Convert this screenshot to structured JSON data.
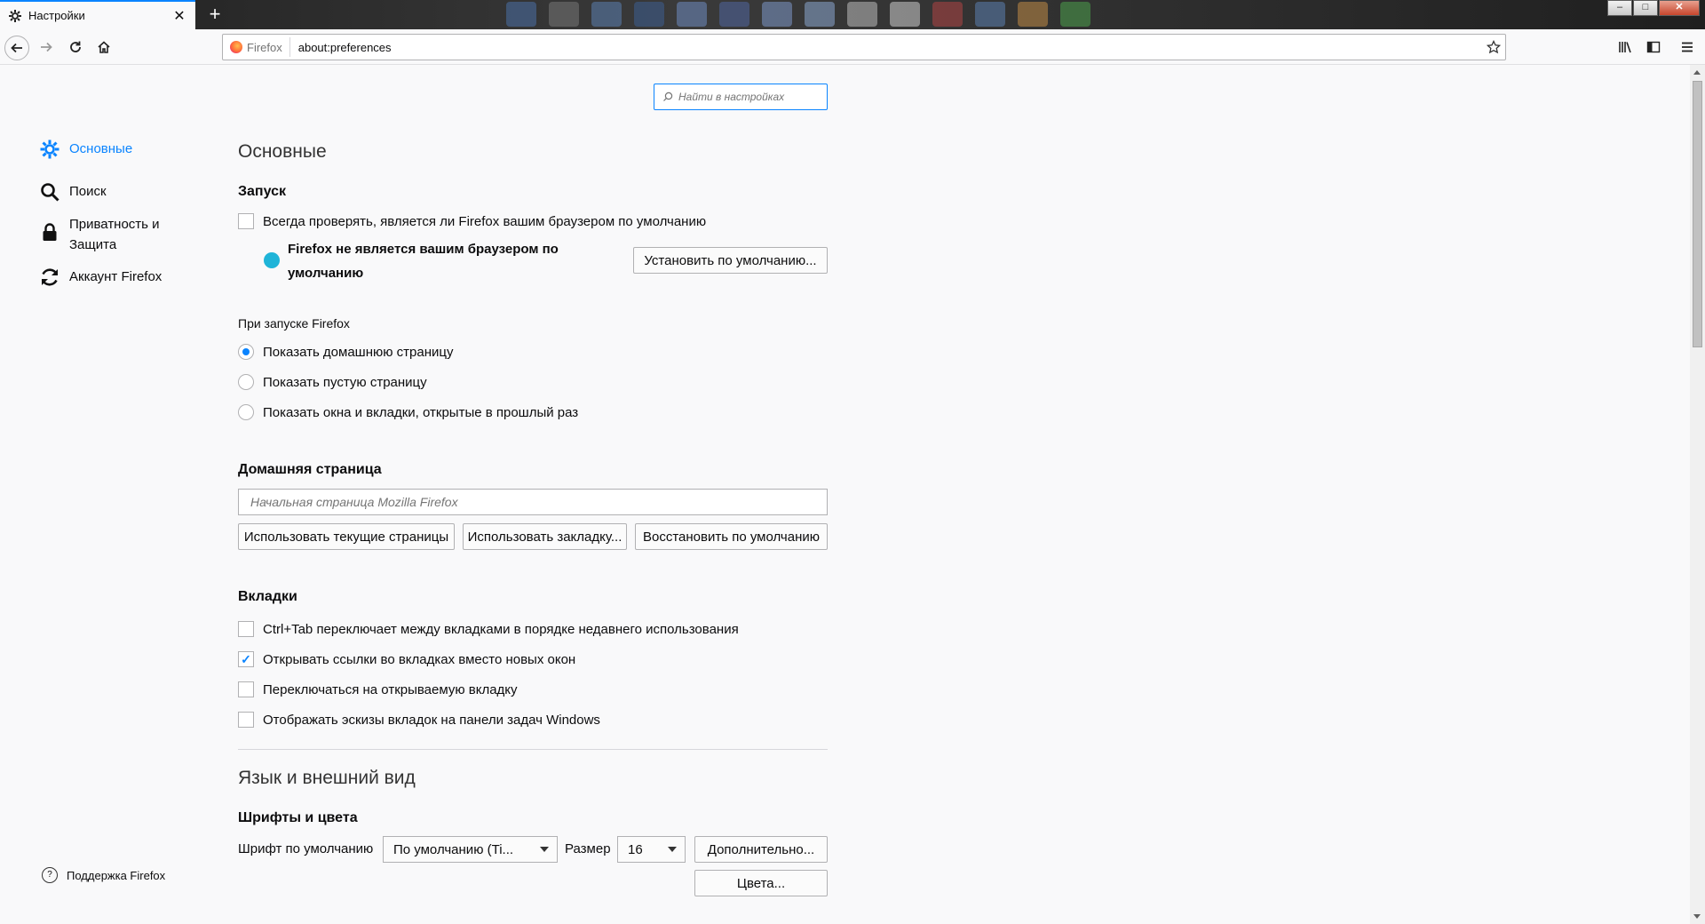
{
  "tab": {
    "title": "Настройки",
    "close": "✕"
  },
  "newtab": "+",
  "window_controls": {
    "minimize": "–",
    "maximize": "□",
    "close": "✕"
  },
  "urlbar": {
    "identity_label": "Firefox",
    "url": "about:preferences"
  },
  "search": {
    "placeholder": "Найти в настройках"
  },
  "sidebar": {
    "items": [
      {
        "label": "Основные",
        "icon": "gear-icon",
        "selected": true
      },
      {
        "label": "Поиск",
        "icon": "search-icon"
      },
      {
        "label": "Приватность и Защита",
        "icon": "lock-icon"
      },
      {
        "label": "Аккаунт Firefox",
        "icon": "sync-icon"
      }
    ],
    "support": "Поддержка Firefox"
  },
  "general": {
    "title": "Основные",
    "startup": {
      "heading": "Запуск",
      "always_check": "Всегда проверять, является ли Firefox вашим браузером по умолчанию",
      "not_default": "Firefox не является вашим браузером по умолчанию",
      "set_default_button": "Установить по умолчанию...",
      "on_start_label": "При запуске Firefox",
      "options": [
        {
          "label": "Показать домашнюю страницу",
          "checked": true
        },
        {
          "label": "Показать пустую страницу",
          "checked": false
        },
        {
          "label": "Показать окна и вкладки, открытые в прошлый раз",
          "checked": false
        }
      ]
    },
    "homepage": {
      "heading": "Домашняя страница",
      "placeholder": "Начальная страница Mozilla Firefox",
      "use_current": "Использовать текущие страницы",
      "use_bookmark": "Использовать закладку...",
      "restore_default": "Восстановить по умолчанию"
    },
    "tabs": {
      "heading": "Вкладки",
      "options": [
        {
          "label": "Ctrl+Tab переключает между вкладками в порядке недавнего использования",
          "checked": false
        },
        {
          "label": "Открывать ссылки во вкладках вместо новых окон",
          "checked": true
        },
        {
          "label": "Переключаться на открываемую вкладку",
          "checked": false
        },
        {
          "label": "Отображать эскизы вкладок на панели задач Windows",
          "checked": false
        }
      ]
    }
  },
  "language": {
    "title": "Язык и внешний вид",
    "fonts": {
      "heading": "Шрифты и цвета",
      "default_font_label": "Шрифт по умолчанию",
      "default_font_value": "По умолчанию (Ti...",
      "size_label": "Размер",
      "size_value": "16",
      "advanced_button": "Дополнительно...",
      "colors_button": "Цвета..."
    }
  },
  "colors": {
    "accent": "#0a84ff",
    "border": "#b1b1b3"
  }
}
